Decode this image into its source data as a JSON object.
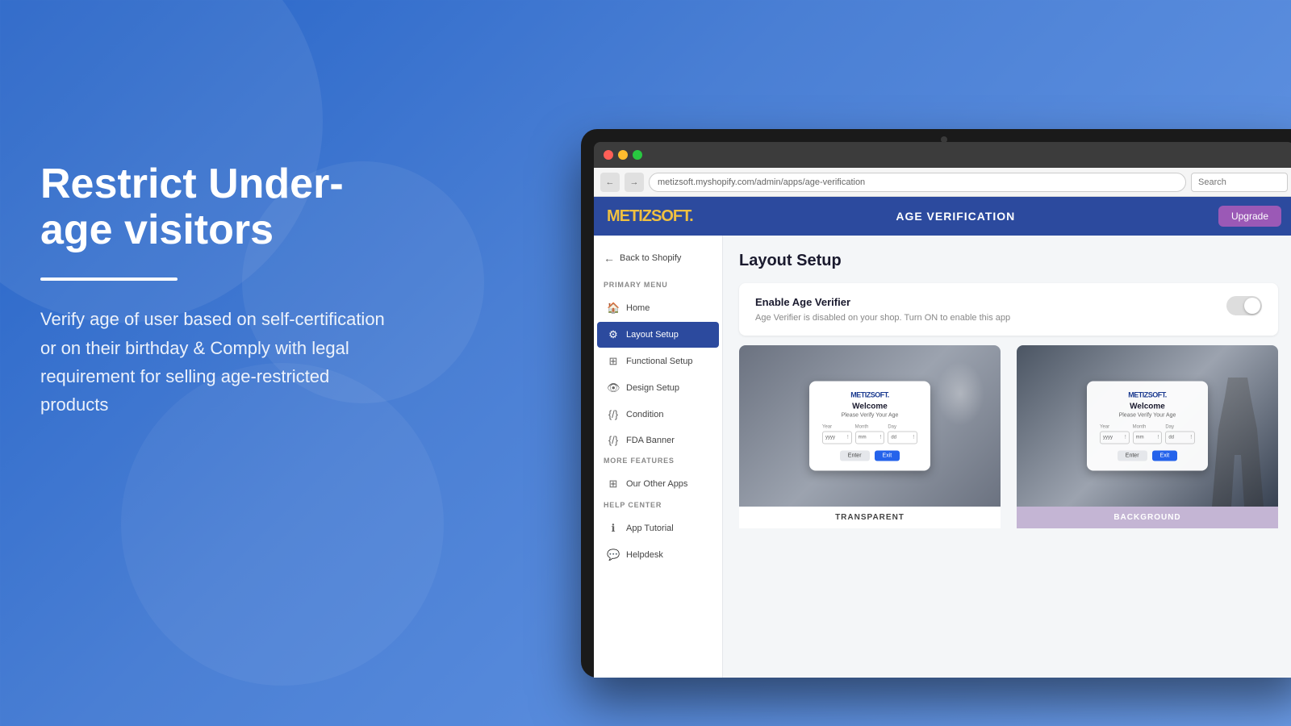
{
  "background": {
    "color": "#3a6fd8"
  },
  "left_panel": {
    "headline": "Restrict Under-age visitors",
    "description": "Verify age of user based on self-certification or on their birthday & Comply with legal requirement for selling age-restricted products"
  },
  "browser": {
    "address": "metizsoft.myshopify.com/admin/apps/age-verification",
    "search_placeholder": "Search"
  },
  "app": {
    "logo": "METIZSOFT.",
    "header_title": "AGE VERIFICATION",
    "header_btn": "Upgrade"
  },
  "sidebar": {
    "back_label": "Back to Shopify",
    "primary_menu_label": "PRIMARY MENU",
    "items": [
      {
        "id": "home",
        "label": "Home",
        "icon": "🏠"
      },
      {
        "id": "layout-setup",
        "label": "Layout Setup",
        "icon": "⚙",
        "active": true
      },
      {
        "id": "functional-setup",
        "label": "Functional Setup",
        "icon": "⊞"
      },
      {
        "id": "design-setup",
        "label": "Design Setup",
        "icon": "👁"
      },
      {
        "id": "condition",
        "label": "Condition",
        "icon": "{}"
      },
      {
        "id": "fda-banner",
        "label": "FDA Banner",
        "icon": "{}"
      }
    ],
    "more_features_label": "MORE FEATURES",
    "more_items": [
      {
        "id": "our-other-apps",
        "label": "Our Other Apps",
        "icon": "⊞"
      }
    ],
    "help_center_label": "HELP CENTER",
    "help_items": [
      {
        "id": "app-tutorial",
        "label": "App Tutorial",
        "icon": "ℹ"
      },
      {
        "id": "helpdesk",
        "label": "Helpdesk",
        "icon": "💬"
      }
    ]
  },
  "main": {
    "page_title": "Layout Setup",
    "enable_card": {
      "title": "Enable Age Verifier",
      "subtitle": "Age Verifier is disabled on your shop. Turn ON to enable this app",
      "toggle_enabled": false
    },
    "previews": [
      {
        "id": "transparent",
        "label": "TRANSPARENT",
        "modal": {
          "logo": "METIZSOFT.",
          "title": "Welcome",
          "subtitle": "Please Verify Your Age",
          "year_label": "Year",
          "month_label": "Month",
          "day_label": "Day",
          "year_placeholder": "yyyy",
          "month_placeholder": "mm",
          "day_placeholder": "dd",
          "enter_btn": "Enter",
          "exit_btn": "Exit"
        }
      },
      {
        "id": "background",
        "label": "BACKGROUND",
        "modal": {
          "logo": "METIZSOFT.",
          "title": "Welcome",
          "subtitle": "Please Verify Your Age",
          "year_label": "Year",
          "month_label": "Month",
          "day_label": "Day",
          "year_placeholder": "yyyy",
          "month_placeholder": "mm",
          "day_placeholder": "dd",
          "enter_btn": "Enter",
          "exit_btn": "Exit"
        }
      }
    ]
  }
}
